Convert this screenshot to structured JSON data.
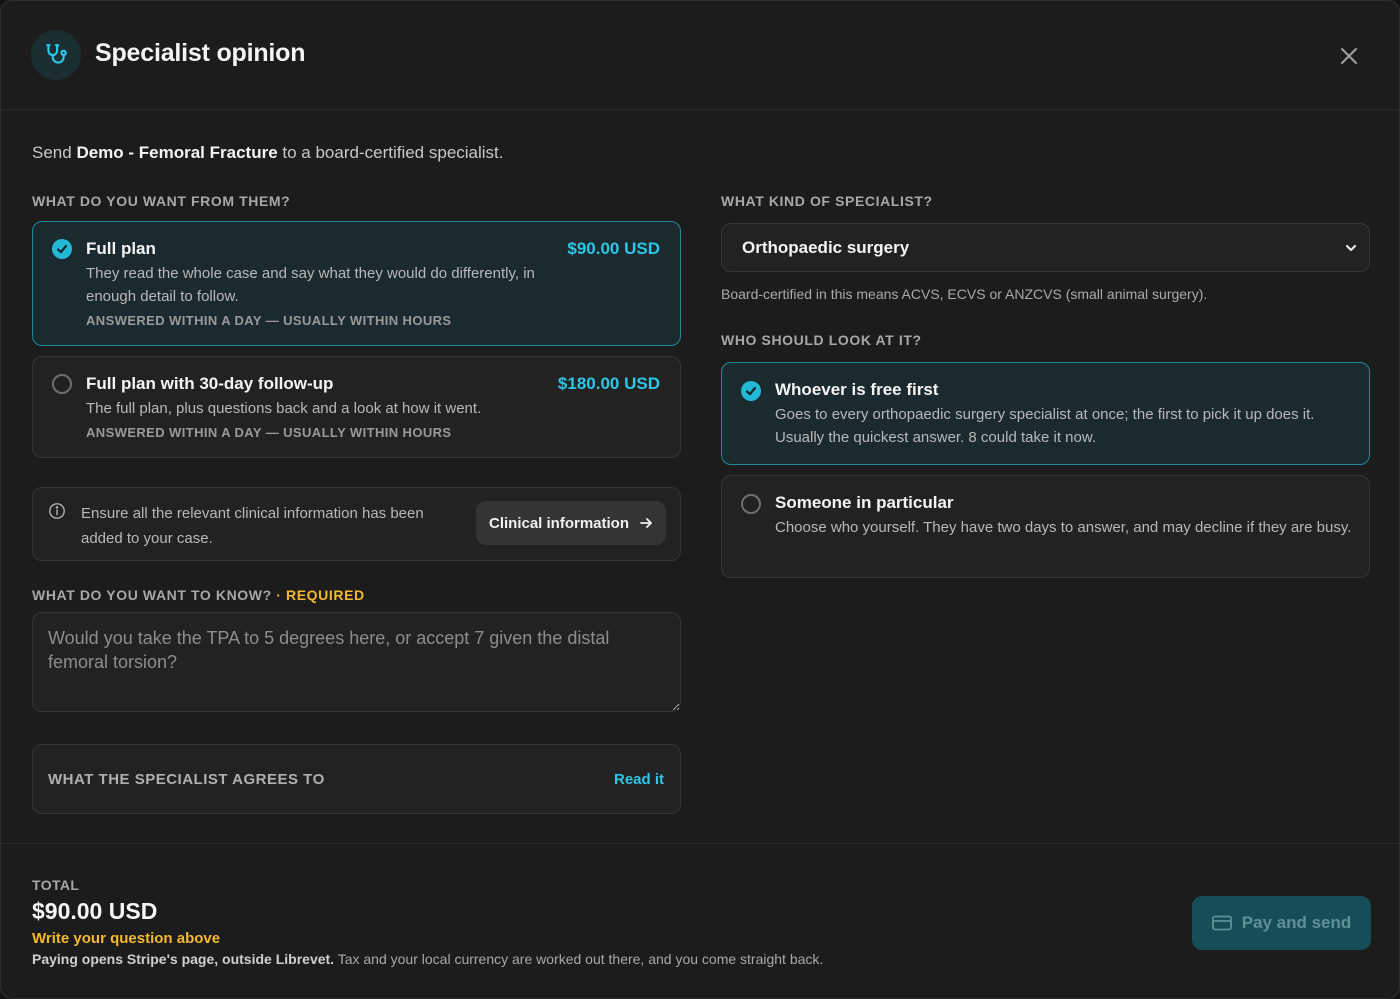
{
  "header": {
    "title": "Specialist opinion",
    "icon": "stethoscope-icon",
    "close_icon": "close-icon"
  },
  "intro": {
    "prefix": "Send ",
    "case_name": "Demo - Femoral Fracture",
    "suffix": " to a board-certified specialist."
  },
  "plan_section": {
    "label": "WHAT DO YOU WANT FROM THEM?",
    "options": [
      {
        "title": "Full plan",
        "price": "$90.00 USD",
        "description": "They read the whole case and say what they would do differently, in enough detail to follow.",
        "meta": "ANSWERED WITHIN A DAY — USUALLY WITHIN HOURS",
        "selected": true
      },
      {
        "title": "Full plan with 30-day follow-up",
        "price": "$180.00 USD",
        "description": "The full plan, plus questions back and a look at how it went.",
        "meta": "ANSWERED WITHIN A DAY — USUALLY WITHIN HOURS",
        "selected": false
      }
    ]
  },
  "info": {
    "text": "Ensure all the relevant clinical information has been added to your case.",
    "button_label": "Clinical information"
  },
  "question": {
    "label": "WHAT DO YOU WANT TO KNOW?",
    "separator": " · ",
    "required_label": "REQUIRED",
    "placeholder": "Would you take the TPA to 5 degrees here, or accept 7 given the distal femoral torsion?",
    "value": ""
  },
  "agreement": {
    "label": "WHAT THE SPECIALIST AGREES TO",
    "link": "Read it"
  },
  "specialist": {
    "label": "WHAT KIND OF SPECIALIST?",
    "selected": "Orthopaedic surgery",
    "hint": "Board-certified in this means ACVS, ECVS or ANZCVS (small animal surgery)."
  },
  "audience": {
    "label": "WHO SHOULD LOOK AT IT?",
    "options": [
      {
        "title": "Whoever is free first",
        "description": "Goes to every orthopaedic surgery specialist at once; the first to pick it up does it. Usually the quickest answer. 8 could take it now.",
        "selected": true
      },
      {
        "title": "Someone in particular",
        "description": "Choose who yourself. They have two days to answer, and may decline if they are busy.",
        "selected": false
      }
    ]
  },
  "footer": {
    "total_label": "TOTAL",
    "total_value": "$90.00 USD",
    "warning": "Write your question above",
    "fine_bold": "Paying opens Stripe's page, outside Librevet.",
    "fine_rest": " Tax and your local currency are worked out there, and you come straight back.",
    "pay_label": "Pay and send",
    "pay_icon": "credit-card-icon"
  },
  "colors": {
    "accent": "#2ec5e6",
    "warning": "#f5b82e",
    "selected_border": "#1d8a99",
    "pay_button": "#174d57"
  }
}
